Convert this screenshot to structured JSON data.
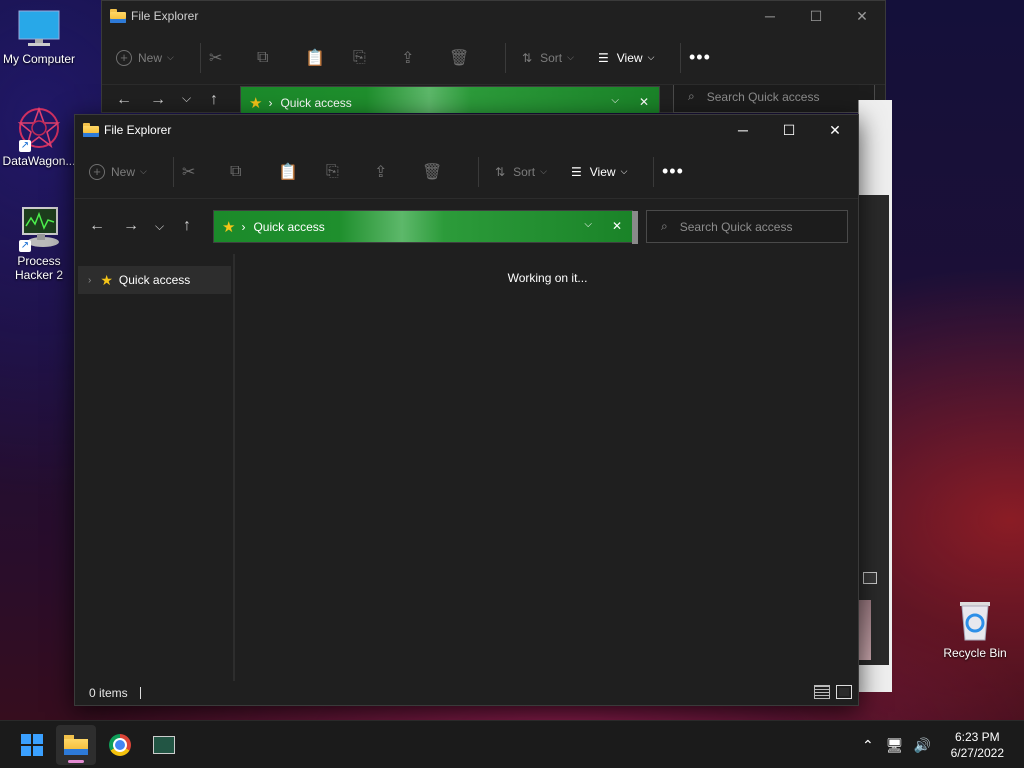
{
  "desktop": {
    "icons": [
      {
        "label": "My Computer"
      },
      {
        "label": "DataWagon..."
      },
      {
        "label": "Process Hacker 2"
      },
      {
        "label": "Recycle Bin"
      }
    ]
  },
  "back_window": {
    "title": "File Explorer",
    "address": "Quick access",
    "search_placeholder": "Search Quick access",
    "toolbar": {
      "new": "New",
      "sort": "Sort",
      "view": "View"
    }
  },
  "front_window": {
    "title": "File Explorer",
    "toolbar": {
      "new": "New",
      "sort": "Sort",
      "view": "View"
    },
    "address": "Quick access",
    "search_placeholder": "Search Quick access",
    "nav_pane": {
      "quick_access": "Quick access"
    },
    "content_status": "Working on it...",
    "status_bar": {
      "items": "0 items"
    }
  },
  "taskbar": {
    "clock": {
      "time": "6:23 PM",
      "date": "6/27/2022"
    }
  }
}
